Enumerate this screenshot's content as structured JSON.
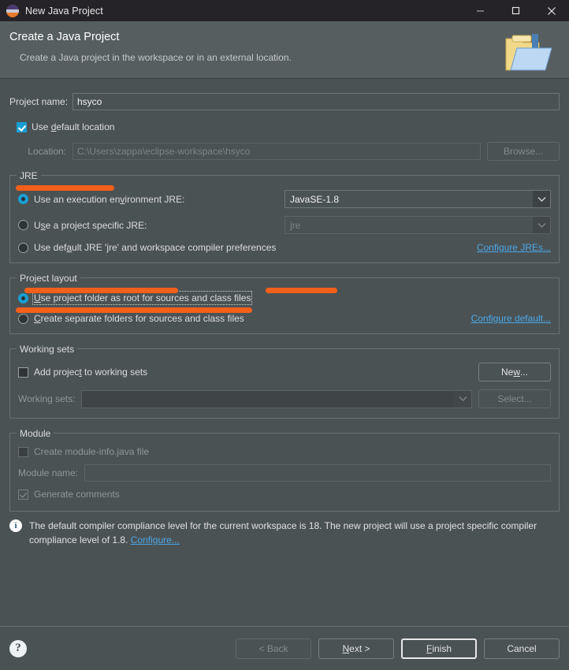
{
  "window": {
    "title": "New Java Project",
    "icon": "java-project-icon",
    "controls": {
      "minimize": "minimize-icon",
      "maximize": "maximize-icon",
      "close": "close-icon"
    }
  },
  "banner": {
    "title": "Create a Java Project",
    "subtitle": "Create a Java project in the workspace or in an external location.",
    "icon": "java-folder-icon"
  },
  "project": {
    "name_label": "Project name:",
    "name_value": "hsyco",
    "use_default_location_label": "Use default location",
    "use_default_location_checked": true,
    "location_label": "Location:",
    "location_value": "C:\\Users\\zappa\\eclipse-workspace\\hsyco",
    "browse_label": "Browse..."
  },
  "jre": {
    "group_title": "JRE",
    "options": [
      {
        "label": "Use an execution environment JRE:",
        "selected": true
      },
      {
        "label": "Use a project specific JRE:",
        "selected": false
      },
      {
        "label": "Use default JRE 'jre' and workspace compiler preferences",
        "selected": false
      }
    ],
    "execution_environment_value": "JavaSE-1.8",
    "project_jre_value": "jre",
    "configure_link": "Configure JREs..."
  },
  "layout": {
    "group_title": "Project layout",
    "options": [
      {
        "label": "Use project folder as root for sources and class files",
        "selected": true
      },
      {
        "label": "Create separate folders for sources and class files",
        "selected": false
      }
    ],
    "configure_link": "Configure default..."
  },
  "working_sets": {
    "group_title": "Working sets",
    "add_label": "Add project to working sets",
    "add_checked": false,
    "sets_label": "Working sets:",
    "sets_value": "",
    "new_label": "New...",
    "select_label": "Select..."
  },
  "module": {
    "group_title": "Module",
    "create_label": "Create module-info.java file",
    "create_checked": false,
    "name_label": "Module name:",
    "name_value": "",
    "comments_label": "Generate comments",
    "comments_checked": true
  },
  "info": {
    "icon": "info-icon",
    "text": "The default compiler compliance level for the current workspace is 18. The new project will use a project specific compiler compliance level of 1.8.",
    "link": "Configure..."
  },
  "footer": {
    "help_label": "?",
    "back_label": "< Back",
    "next_label": "Next >",
    "finish_label": "Finish",
    "cancel_label": "Cancel"
  },
  "colors": {
    "accent_highlight": "#f4601a",
    "link": "#4aa8e8",
    "selection": "#1a9fd4",
    "background": "#4b5254",
    "titlebar": "#252328"
  }
}
